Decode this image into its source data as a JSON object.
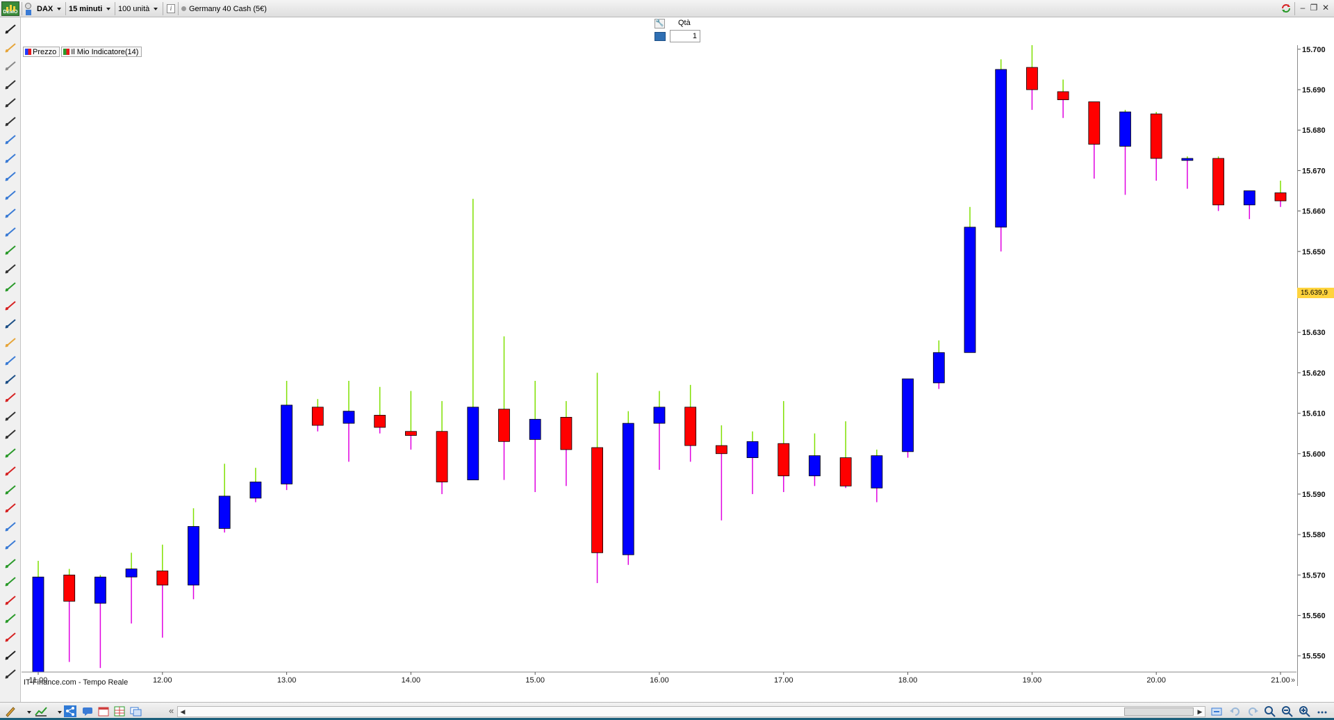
{
  "toolbar": {
    "instrument": "DAX",
    "timeframe": "15 minuti",
    "units": "100 unità",
    "product": "Germany 40 Cash (5€)",
    "logo_text": "DEMO"
  },
  "qty_panel": {
    "label": "Qtà",
    "value": "1"
  },
  "legend": [
    {
      "label": "Prezzo"
    },
    {
      "label": "Il Mio Indicatore(14)"
    }
  ],
  "source": "IT-Finance.com - Tempo Reale",
  "colors": {
    "bull_body": "#0000ff",
    "bear_body": "#ff0000",
    "upper_wick": "#7fe000",
    "lower_wick": "#e000e0",
    "last_price_bg": "#ffd33d"
  },
  "chart_data": {
    "type": "candlestick",
    "ylim": [
      15546,
      15701
    ],
    "yticks": [
      "15.700",
      "15.690",
      "15.680",
      "15.670",
      "15.660",
      "15.650",
      "15.630",
      "15.620",
      "15.610",
      "15.600",
      "15.590",
      "15.580",
      "15.570",
      "15.560",
      "15.550"
    ],
    "ytick_values": [
      15700,
      15690,
      15680,
      15670,
      15660,
      15650,
      15630,
      15620,
      15610,
      15600,
      15590,
      15580,
      15570,
      15560,
      15550
    ],
    "xticks": [
      "11.00",
      "12.00",
      "13.00",
      "14.00",
      "15.00",
      "16.00",
      "17.00",
      "18.00",
      "19.00",
      "20.00",
      "21.00"
    ],
    "xtick_index": [
      0,
      4,
      8,
      12,
      16,
      20,
      24,
      28,
      32,
      36,
      40
    ],
    "last_price": "15.639,9",
    "last_price_value": 15639.9,
    "candles": [
      {
        "time": "11.00",
        "open": 15546.0,
        "close": 15569.5,
        "high": 15573.5,
        "low": 15546.0,
        "dir": "up"
      },
      {
        "time": "11.15",
        "open": 15570.0,
        "close": 15563.5,
        "high": 15571.5,
        "low": 15548.5,
        "dir": "down"
      },
      {
        "time": "11.30",
        "open": 15563.0,
        "close": 15569.5,
        "high": 15570.0,
        "low": 15547.0,
        "dir": "up"
      },
      {
        "time": "11.45",
        "open": 15569.5,
        "close": 15571.5,
        "high": 15575.5,
        "low": 15558.0,
        "dir": "up"
      },
      {
        "time": "12.00",
        "open": 15571.0,
        "close": 15567.5,
        "high": 15577.5,
        "low": 15554.5,
        "dir": "down"
      },
      {
        "time": "12.15",
        "open": 15567.5,
        "close": 15582.0,
        "high": 15586.5,
        "low": 15564.0,
        "dir": "up"
      },
      {
        "time": "12.30",
        "open": 15581.5,
        "close": 15589.5,
        "high": 15597.5,
        "low": 15580.5,
        "dir": "up"
      },
      {
        "time": "12.45",
        "open": 15589.0,
        "close": 15593.0,
        "high": 15596.5,
        "low": 15588.0,
        "dir": "up"
      },
      {
        "time": "13.00",
        "open": 15592.5,
        "close": 15612.0,
        "high": 15618.0,
        "low": 15591.0,
        "dir": "up"
      },
      {
        "time": "13.15",
        "open": 15611.5,
        "close": 15607.0,
        "high": 15613.5,
        "low": 15605.5,
        "dir": "down"
      },
      {
        "time": "13.30",
        "open": 15607.5,
        "close": 15610.5,
        "high": 15618.0,
        "low": 15598.0,
        "dir": "up"
      },
      {
        "time": "13.45",
        "open": 15609.5,
        "close": 15606.5,
        "high": 15616.5,
        "low": 15605.0,
        "dir": "down"
      },
      {
        "time": "14.00",
        "open": 15605.5,
        "close": 15604.5,
        "high": 15615.5,
        "low": 15601.0,
        "dir": "down"
      },
      {
        "time": "14.15",
        "open": 15605.5,
        "close": 15593.0,
        "high": 15613.0,
        "low": 15590.0,
        "dir": "down"
      },
      {
        "time": "14.30",
        "open": 15593.5,
        "close": 15611.5,
        "high": 15663.0,
        "low": 15593.5,
        "dir": "up"
      },
      {
        "time": "14.45",
        "open": 15611.0,
        "close": 15603.0,
        "high": 15629.0,
        "low": 15593.5,
        "dir": "down"
      },
      {
        "time": "15.00",
        "open": 15603.5,
        "close": 15608.5,
        "high": 15618.0,
        "low": 15590.5,
        "dir": "up"
      },
      {
        "time": "15.15",
        "open": 15609.0,
        "close": 15601.0,
        "high": 15613.0,
        "low": 15592.0,
        "dir": "down"
      },
      {
        "time": "15.30",
        "open": 15601.5,
        "close": 15575.5,
        "high": 15620.0,
        "low": 15568.0,
        "dir": "down"
      },
      {
        "time": "15.45",
        "open": 15575.0,
        "close": 15607.5,
        "high": 15610.5,
        "low": 15572.5,
        "dir": "up"
      },
      {
        "time": "16.00",
        "open": 15607.5,
        "close": 15611.5,
        "high": 15615.5,
        "low": 15596.0,
        "dir": "up"
      },
      {
        "time": "16.15",
        "open": 15611.5,
        "close": 15602.0,
        "high": 15617.0,
        "low": 15598.0,
        "dir": "down"
      },
      {
        "time": "16.30",
        "open": 15602.0,
        "close": 15600.0,
        "high": 15607.0,
        "low": 15583.5,
        "dir": "down"
      },
      {
        "time": "16.45",
        "open": 15599.0,
        "close": 15603.0,
        "high": 15605.5,
        "low": 15590.0,
        "dir": "up"
      },
      {
        "time": "17.00",
        "open": 15602.5,
        "close": 15594.5,
        "high": 15613.0,
        "low": 15590.5,
        "dir": "down"
      },
      {
        "time": "17.15",
        "open": 15594.5,
        "close": 15599.5,
        "high": 15605.0,
        "low": 15592.0,
        "dir": "up"
      },
      {
        "time": "17.30",
        "open": 15599.0,
        "close": 15592.0,
        "high": 15608.0,
        "low": 15591.5,
        "dir": "down"
      },
      {
        "time": "17.45",
        "open": 15591.5,
        "close": 15599.5,
        "high": 15601.0,
        "low": 15588.0,
        "dir": "up"
      },
      {
        "time": "18.00",
        "open": 15600.5,
        "close": 15618.5,
        "high": 15618.5,
        "low": 15599.0,
        "dir": "up"
      },
      {
        "time": "18.15",
        "open": 15617.5,
        "close": 15625.0,
        "high": 15628.0,
        "low": 15616.0,
        "dir": "up"
      },
      {
        "time": "18.30",
        "open": 15625.0,
        "close": 15656.0,
        "high": 15661.0,
        "low": 15625.0,
        "dir": "up"
      },
      {
        "time": "18.45",
        "open": 15656.0,
        "close": 15695.0,
        "high": 15697.5,
        "low": 15650.0,
        "dir": "up"
      },
      {
        "time": "19.00",
        "open": 15695.5,
        "close": 15690.0,
        "high": 15701.0,
        "low": 15685.0,
        "dir": "down"
      },
      {
        "time": "19.15",
        "open": 15689.5,
        "close": 15687.5,
        "high": 15692.5,
        "low": 15683.0,
        "dir": "down"
      },
      {
        "time": "19.30",
        "open": 15687.0,
        "close": 15676.5,
        "high": 15687.0,
        "low": 15668.0,
        "dir": "down"
      },
      {
        "time": "19.45",
        "open": 15676.0,
        "close": 15684.5,
        "high": 15685.0,
        "low": 15664.0,
        "dir": "up"
      },
      {
        "time": "20.00",
        "open": 15684.0,
        "close": 15673.0,
        "high": 15684.5,
        "low": 15667.5,
        "dir": "down"
      },
      {
        "time": "20.15",
        "open": 15672.5,
        "close": 15673.0,
        "high": 15673.5,
        "low": 15665.5,
        "dir": "up"
      },
      {
        "time": "20.30",
        "open": 15673.0,
        "close": 15661.5,
        "high": 15673.5,
        "low": 15660.0,
        "dir": "down"
      },
      {
        "time": "20.45",
        "open": 15661.5,
        "close": 15665.0,
        "high": 15665.0,
        "low": 15658.0,
        "dir": "up"
      },
      {
        "time": "21.00",
        "open": 15664.5,
        "close": 15662.5,
        "high": 15667.5,
        "low": 15661.0,
        "dir": "down"
      }
    ]
  },
  "sidebar_tools": [
    "pencil-icon",
    "bell-icon",
    "ruler-icon",
    "line-icon",
    "horizontal-line-icon",
    "vertical-line-icon",
    "channel-icon",
    "fibonacci-icon",
    "fib-fan-icon",
    "fib-retracement-icon",
    "fib-extension-icon",
    "fib-timezone-icon",
    "andrews-icon",
    "arrow-line-icon",
    "up-arrow-icon",
    "down-arrow-icon",
    "ellipse-icon",
    "ellipse-orange-icon",
    "rectangle-icon",
    "triangle-icon",
    "eraser-icon",
    "segment-icon",
    "vertical-segment-icon",
    "green-line-icon",
    "red-line-icon",
    "green-hline-icon",
    "red-hline-icon",
    "percent-icon",
    "range-icon",
    "measure-icon",
    "check-icon",
    "cross-icon",
    "thumbs-up-icon",
    "thumbs-down-icon",
    "right-arrow-icon",
    "more-icon"
  ]
}
